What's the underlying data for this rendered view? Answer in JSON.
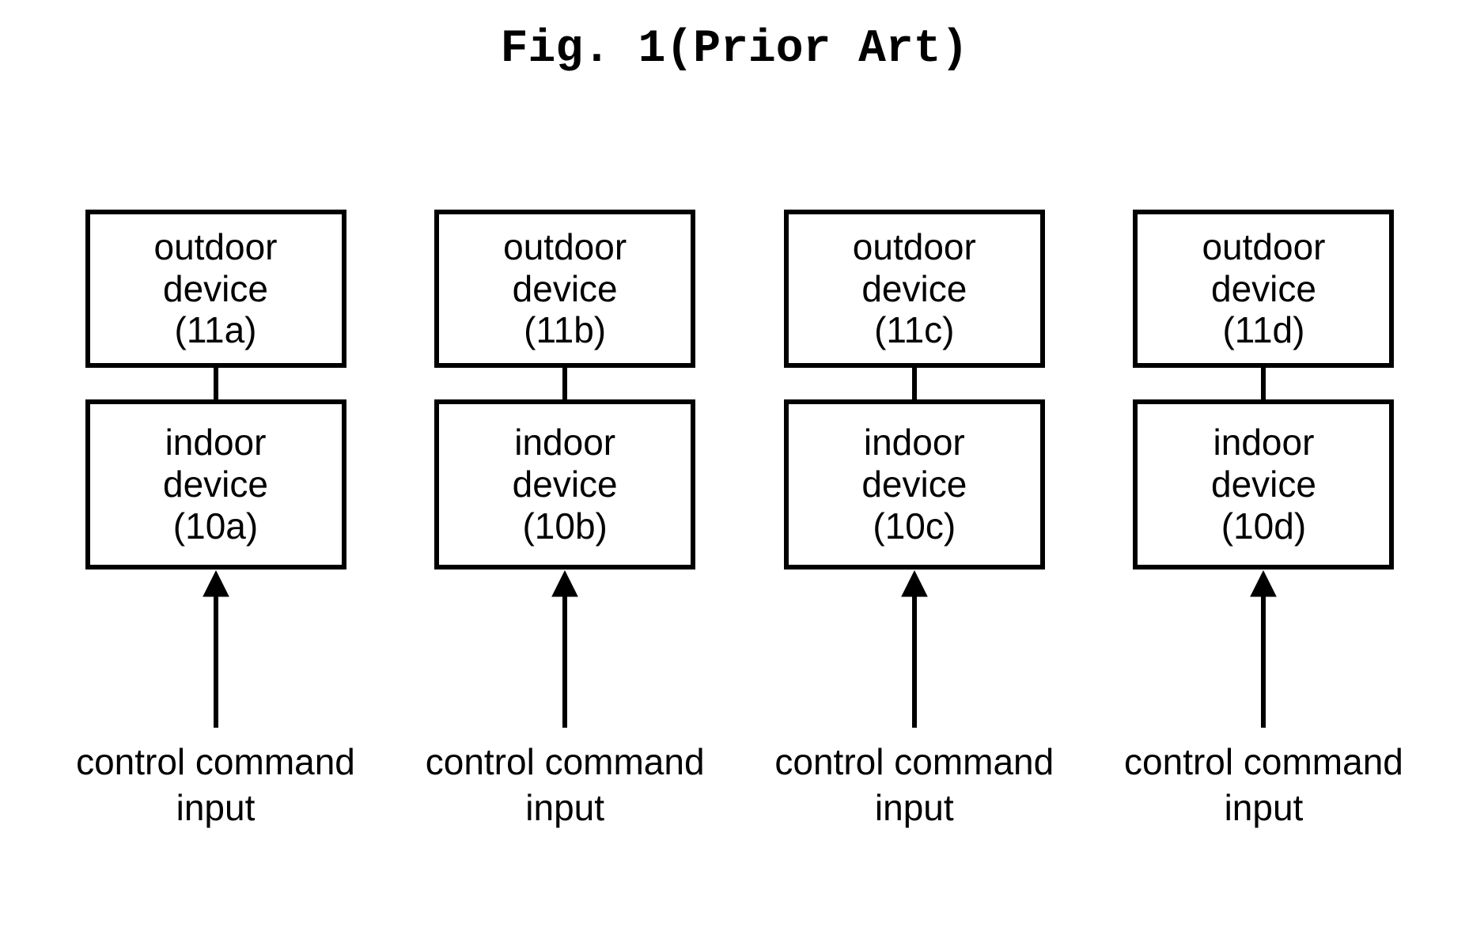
{
  "title": "Fig. 1(Prior Art)",
  "columns": [
    {
      "outdoor_line1": "outdoor",
      "outdoor_line2": "device",
      "outdoor_ref": "(11a)",
      "indoor_line1": "indoor",
      "indoor_line2": "device",
      "indoor_ref": "(10a)",
      "input_line1": "control command",
      "input_line2": "input"
    },
    {
      "outdoor_line1": "outdoor",
      "outdoor_line2": "device",
      "outdoor_ref": "(11b)",
      "indoor_line1": "indoor",
      "indoor_line2": "device",
      "indoor_ref": "(10b)",
      "input_line1": "control command",
      "input_line2": "input"
    },
    {
      "outdoor_line1": "outdoor",
      "outdoor_line2": "device",
      "outdoor_ref": "(11c)",
      "indoor_line1": "indoor",
      "indoor_line2": "device",
      "indoor_ref": "(10c)",
      "input_line1": "control command",
      "input_line2": "input"
    },
    {
      "outdoor_line1": "outdoor",
      "outdoor_line2": "device",
      "outdoor_ref": "(11d)",
      "indoor_line1": "indoor",
      "indoor_line2": "device",
      "indoor_ref": "(10d)",
      "input_line1": "control command",
      "input_line2": "input"
    }
  ]
}
